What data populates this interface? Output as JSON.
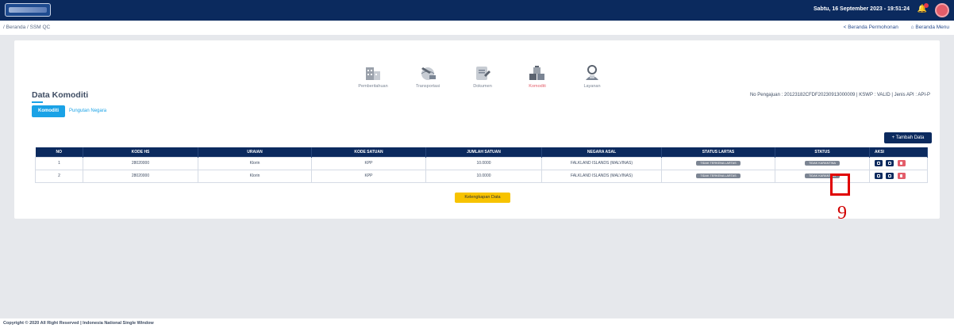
{
  "header": {
    "datetime": "Sabtu, 16 September 2023 - 19:51:24",
    "notification_icon": "bell-icon",
    "avatar_icon": "user-avatar-icon"
  },
  "breadcrumb": "/ Beranda / SSM QC",
  "sublinks": {
    "beranda_permohonan": "< Beranda Permohonan",
    "beranda_menu": "⌂ Beranda Menu"
  },
  "menu": [
    {
      "label": "Pemberitahuan",
      "icon": "building-icon"
    },
    {
      "label": "Transportasi",
      "icon": "globe-transport-icon"
    },
    {
      "label": "Dokumen",
      "icon": "document-icon"
    },
    {
      "label": "Komoditi",
      "icon": "commodity-icon"
    },
    {
      "label": "Layanan",
      "icon": "service-person-icon"
    }
  ],
  "section_title": "Data Komoditi",
  "no_pengajuan": "No Pengajuan : 20123182CFDF20230913000009 | KSWP : VALID | Jenis API : API-P",
  "tabs": {
    "active": "Komoditi",
    "inactive": "Pungutan Negara"
  },
  "add_button": "+   Tambah Data",
  "table": {
    "headers": [
      "NO",
      "KODE HS",
      "URAIAN",
      "KODE SATUAN",
      "JUMLAH SATUAN",
      "NEGARA ASAL",
      "STATUS LARTAS",
      "STATUS",
      "AKSI"
    ],
    "rows": [
      {
        "no": "1",
        "kode_hs": "28020000",
        "uraian": "Klorin",
        "kode_satuan": "KPP",
        "jumlah": "10.0000",
        "negara": "FALKLAND ISLANDS (MALVINAS)",
        "status_lartas": "TIDAK TERKENA LARTAS",
        "status": "TIDAK KARANTINA"
      },
      {
        "no": "2",
        "kode_hs": "28020000",
        "uraian": "Klorin",
        "kode_satuan": "KPP",
        "jumlah": "10.0000",
        "negara": "FALKLAND ISLANDS (MALVINAS)",
        "status_lartas": "TIDAK TERKENA LARTAS",
        "status": "TIDAK KARANTINA"
      }
    ]
  },
  "lengkapi_button": "Kelengkapan Data",
  "annotation_number": "9",
  "footer": "Copyright © 2020 All Right Reserved | Indonesia National Single Window",
  "colors": {
    "navy": "#0b2a5e",
    "accent_blue": "#1aa2e6",
    "danger": "#e35d6a",
    "warning": "#f7c300",
    "annotation_red": "#e00000"
  }
}
